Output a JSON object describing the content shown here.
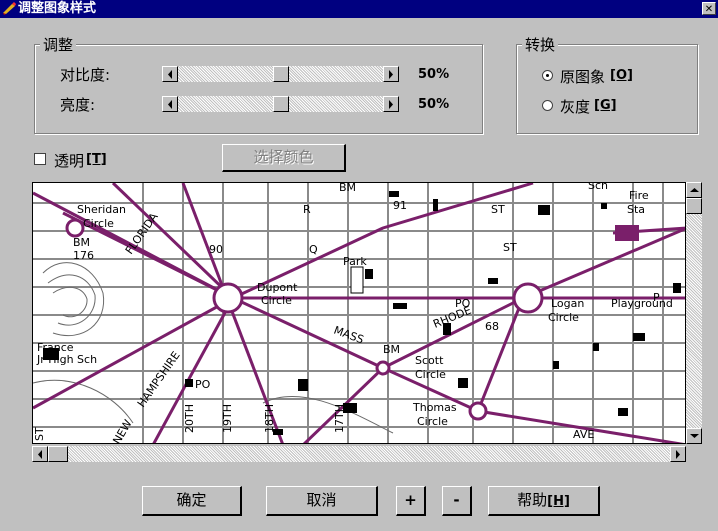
{
  "window": {
    "title": "调整图象样式",
    "close_glyph": "✕"
  },
  "adjust_group": {
    "legend": "调整",
    "contrast": {
      "label": "对比度:",
      "value_text": "50%",
      "value": 0.5
    },
    "brightness": {
      "label": "亮度:",
      "value_text": "50%",
      "value": 0.5
    }
  },
  "convert_group": {
    "legend": "转换",
    "options": [
      {
        "label": "原图象",
        "shortcut": "[O]",
        "selected": true
      },
      {
        "label": "灰度",
        "shortcut": "[G]",
        "selected": false
      }
    ]
  },
  "transparent": {
    "label": "透明",
    "shortcut": "[T]",
    "checked": false
  },
  "choose_color_button": "选择颜色",
  "map": {
    "labels": [
      "Sheridan",
      "Circle",
      "BM",
      "176",
      "Dupont",
      "Circle",
      "Park",
      "MASS",
      "RHODE",
      "PO",
      "68",
      "Logan",
      "Circle",
      "Playground",
      "BM",
      "Scott",
      "Circle",
      "Thomas",
      "Circle",
      "France",
      "Jr High Sch",
      "PO",
      "HAMPSHIRE",
      "FLORIDA",
      "Fire",
      "Sta",
      "Sch",
      "BM",
      "91",
      "R",
      "Q",
      "ST",
      "ST",
      "20TH",
      "19TH",
      "18TH",
      "17TH",
      "NEW",
      "AVE",
      "90",
      "P",
      "ST"
    ],
    "colors": {
      "roads": "#7a1f6a",
      "streets": "#8a8a8a",
      "ink": "#000000",
      "bg": "#ffffff"
    }
  },
  "buttons": {
    "ok": "确定",
    "cancel": "取消",
    "zoom_in": "+",
    "zoom_out": "-",
    "help": "帮助",
    "help_shortcut": "[H]"
  },
  "icons": {
    "left": "arrow-left-icon",
    "right": "arrow-right-icon",
    "up": "arrow-up-icon",
    "down": "arrow-down-icon"
  }
}
